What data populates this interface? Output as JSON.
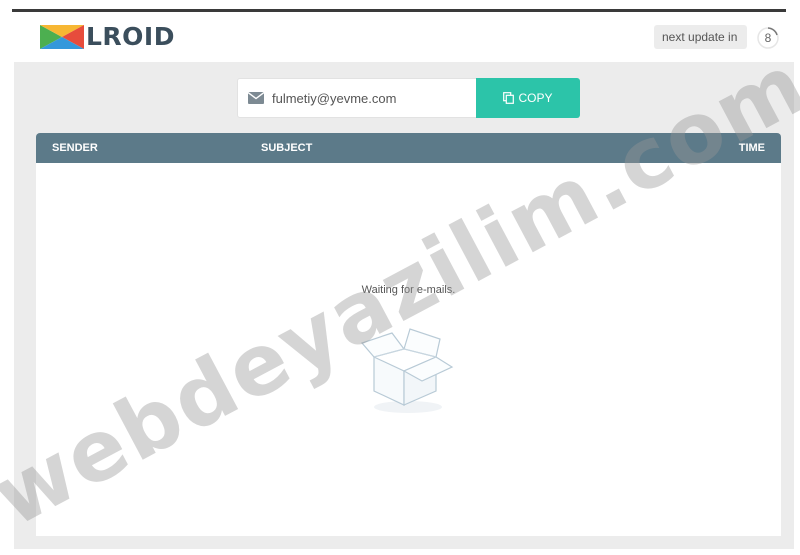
{
  "header": {
    "logo_text": "LROID",
    "update_label": "next update in",
    "update_count": "8"
  },
  "email": {
    "address": "fulmetiy@yevme.com",
    "copy_label": "COPY"
  },
  "table": {
    "columns": [
      "SENDER",
      "SUBJECT",
      "TIME"
    ],
    "empty_message": "Waiting for e-mails."
  },
  "watermark": "webdeyazilim.com",
  "colors": {
    "accent": "#2cc4a9",
    "table_header": "#5c7a89",
    "logo_text": "#3b4e5c"
  }
}
